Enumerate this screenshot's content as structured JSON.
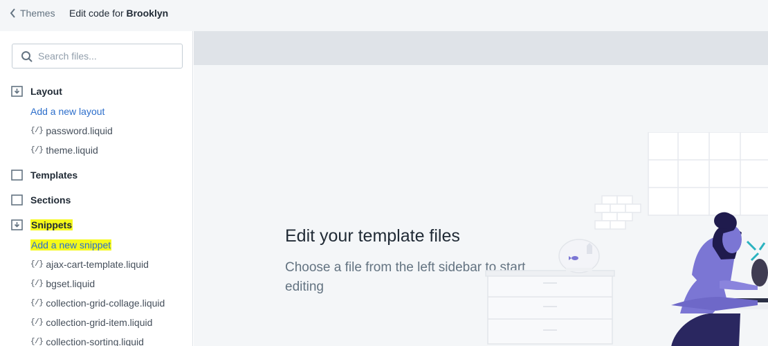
{
  "header": {
    "back_label": "Themes",
    "title_prefix": "Edit code for ",
    "theme_name": "Brooklyn"
  },
  "sidebar": {
    "search_placeholder": "Search files...",
    "folders": {
      "layout": {
        "label": "Layout",
        "add_label": "Add a new layout",
        "files": [
          "password.liquid",
          "theme.liquid"
        ]
      },
      "templates": {
        "label": "Templates"
      },
      "sections": {
        "label": "Sections"
      },
      "snippets": {
        "label": "Snippets",
        "add_label": "Add a new snippet",
        "files": [
          "ajax-cart-template.liquid",
          "bgset.liquid",
          "collection-grid-collage.liquid",
          "collection-grid-item.liquid",
          "collection-sorting.liquid"
        ]
      }
    },
    "file_icon_glyph": "{/}"
  },
  "main": {
    "heading": "Edit your template files",
    "subtext": "Choose a file from the left sidebar to start editing"
  },
  "colors": {
    "link": "#2c6ecb",
    "highlight": "#f5f91a",
    "illustration_accent": "#7b76d4",
    "illustration_dark": "#1f1b4d"
  },
  "icons": {
    "back": "chevron-left-icon",
    "search": "search-icon",
    "folder_open": "folder-download-icon",
    "folder_closed": "folder-icon",
    "file": "code-file-icon"
  }
}
